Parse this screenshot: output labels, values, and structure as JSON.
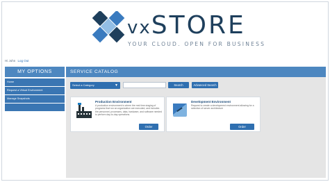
{
  "brand": {
    "name_prefix": "vx",
    "name": "STORE",
    "tagline": "YOUR CLOUD. OPEN FOR BUSINESS",
    "colors": {
      "dark": "#1e3f5c",
      "blue": "#3a7bbf",
      "light": "#7fb3e0"
    }
  },
  "user": {
    "greeting": "Hi John",
    "logout_label": "Log Out"
  },
  "sidebar": {
    "title": "MY OPTIONS",
    "items": [
      {
        "label": "Home"
      },
      {
        "label": "Request a Virtual Environment"
      },
      {
        "label": "Manage Snapshots"
      },
      {
        "label": ""
      }
    ]
  },
  "catalog": {
    "title": "SERVICE CATALOG",
    "category_select": {
      "selected": "Select a Category",
      "icon": "caret-down-icon"
    },
    "search": {
      "value": "",
      "button_label": "Search",
      "advanced_label": "Advanced Search"
    },
    "items": [
      {
        "title": "Production Environment",
        "description": "A production environment is where the real time staging of programs that run an organization are executed, and includes the personnel, processes, data, hardware, and software needed to perform day-to-day operations.",
        "order_label": "Order",
        "icon": "factory-icon"
      },
      {
        "title": "Development Environment",
        "description": "Request to create a development environment allowing for a selection of server architecture",
        "order_label": "Order",
        "icon": "development-icon"
      }
    ]
  },
  "colors": {
    "header": "#4d87c0",
    "nav": "#3a76b3",
    "button": "#2f6fb0",
    "panel": "#e5e5e5"
  }
}
